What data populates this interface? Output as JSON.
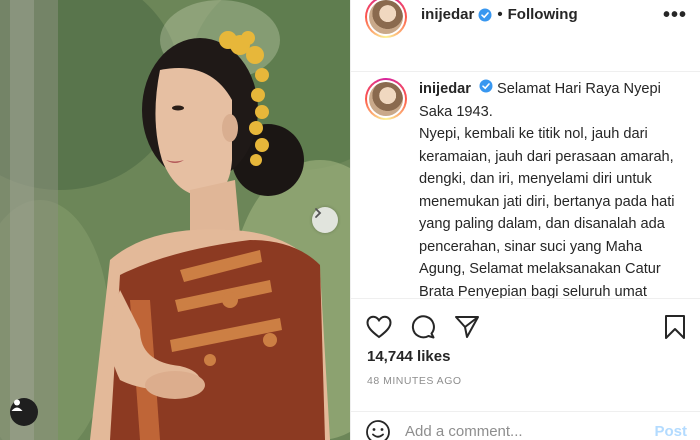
{
  "post": {
    "username": "inijedar",
    "follow_status": "Following",
    "separator": "•",
    "more_label": "•••",
    "caption": {
      "username": "inijedar",
      "text": "Selamat Hari Raya Nyepi Saka 1943.",
      "body": "Nyepi, kembali ke titik nol, jauh dari keramaian, jauh dari perasaan amarah, dengki, dan iri, menyelami diri untuk menemukan jati diri, bertanya pada hati yang paling dalam, dan disanalah ada pencerahan, sinar suci yang Maha Agung, Selamat melaksanakan Catur Brata Penyepian bagi seluruh umat"
    },
    "likes": "14,744 likes",
    "time": "48 MINUTES AGO",
    "comment": {
      "placeholder": "Add a comment...",
      "post_label": "Post"
    }
  },
  "icons": {
    "verified": "verified-badge-icon",
    "like": "heart-icon",
    "comment": "comment-bubble-icon",
    "share": "paper-plane-icon",
    "save": "bookmark-icon",
    "emoji": "smiley-icon",
    "carousel_next": "chevron-right-icon",
    "tag_user": "user-tag-icon"
  },
  "colors": {
    "verified_blue": "#3897f0",
    "post_button_disabled": "#b3dbff",
    "text_primary": "#262626",
    "text_secondary": "#8e8e8e"
  }
}
